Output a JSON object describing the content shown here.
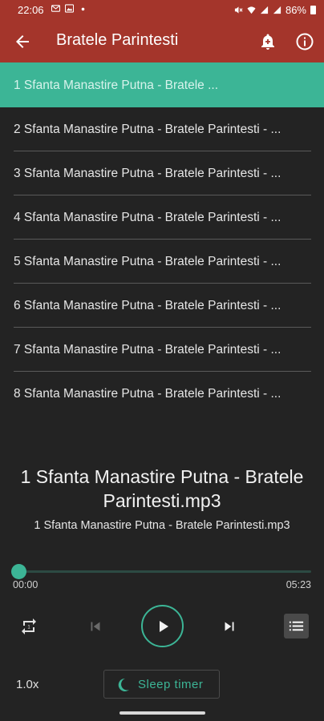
{
  "status_bar": {
    "time": "22:06",
    "battery": "86%",
    "icons": [
      "gmail-icon",
      "image-icon",
      "dot-icon",
      "mute-icon",
      "wifi-icon",
      "signal-icon",
      "signal-icon",
      "battery-icon"
    ]
  },
  "app_bar": {
    "title": "Bratele Parintesti",
    "icons": [
      "back-arrow-icon",
      "bell-plus-icon",
      "info-icon"
    ]
  },
  "playlist": {
    "items": [
      {
        "label": "1 Sfanta Manastire Putna - Bratele ...",
        "active": true
      },
      {
        "label": "2 Sfanta Manastire Putna - Bratele Parintesti - ..."
      },
      {
        "label": "3 Sfanta Manastire Putna - Bratele Parintesti - ..."
      },
      {
        "label": "4 Sfanta Manastire Putna - Bratele Parintesti - ..."
      },
      {
        "label": "5 Sfanta Manastire Putna - Bratele Parintesti - ..."
      },
      {
        "label": "6 Sfanta Manastire Putna - Bratele Parintesti - ..."
      },
      {
        "label": "7 Sfanta Manastire Putna - Bratele Parintesti - ..."
      },
      {
        "label": "8 Sfanta Manastire Putna - Bratele Parintesti - ..."
      }
    ]
  },
  "now_playing": {
    "title_line1": "1 Sfanta Manastire Putna - Bratele",
    "title_line2": "Parintesti.mp3",
    "subtitle": "1 Sfanta Manastire Putna - Bratele Parintesti.mp3",
    "elapsed": "00:00",
    "total": "05:23",
    "progress": 0.0
  },
  "controls": {
    "icons": [
      "repeat-icon",
      "skip-previous-icon",
      "play-icon",
      "skip-next-icon",
      "playlist-icon"
    ],
    "speed": "1.0x",
    "sleep_timer": "Sleep timer"
  },
  "colors": {
    "accent": "#3cb596",
    "bar": "#a4352b",
    "background": "#232323"
  }
}
